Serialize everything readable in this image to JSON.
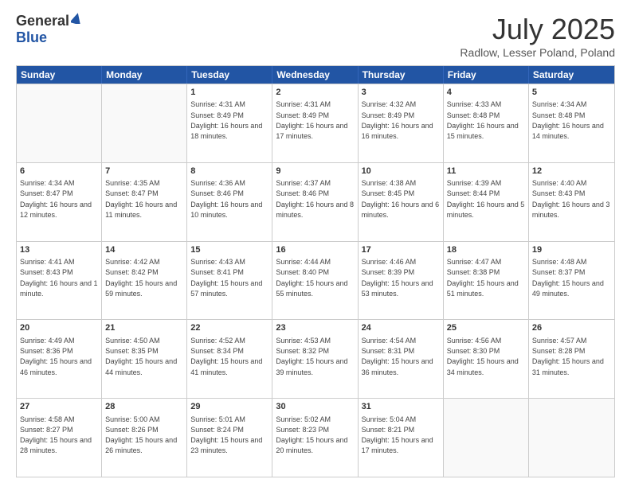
{
  "header": {
    "logo_general": "General",
    "logo_blue": "Blue",
    "month_title": "July 2025",
    "location": "Radlow, Lesser Poland, Poland"
  },
  "weekdays": [
    "Sunday",
    "Monday",
    "Tuesday",
    "Wednesday",
    "Thursday",
    "Friday",
    "Saturday"
  ],
  "weeks": [
    [
      {
        "day": "",
        "sunrise": "",
        "sunset": "",
        "daylight": "",
        "empty": true
      },
      {
        "day": "",
        "sunrise": "",
        "sunset": "",
        "daylight": "",
        "empty": true
      },
      {
        "day": "1",
        "sunrise": "Sunrise: 4:31 AM",
        "sunset": "Sunset: 8:49 PM",
        "daylight": "Daylight: 16 hours and 18 minutes.",
        "empty": false
      },
      {
        "day": "2",
        "sunrise": "Sunrise: 4:31 AM",
        "sunset": "Sunset: 8:49 PM",
        "daylight": "Daylight: 16 hours and 17 minutes.",
        "empty": false
      },
      {
        "day": "3",
        "sunrise": "Sunrise: 4:32 AM",
        "sunset": "Sunset: 8:49 PM",
        "daylight": "Daylight: 16 hours and 16 minutes.",
        "empty": false
      },
      {
        "day": "4",
        "sunrise": "Sunrise: 4:33 AM",
        "sunset": "Sunset: 8:48 PM",
        "daylight": "Daylight: 16 hours and 15 minutes.",
        "empty": false
      },
      {
        "day": "5",
        "sunrise": "Sunrise: 4:34 AM",
        "sunset": "Sunset: 8:48 PM",
        "daylight": "Daylight: 16 hours and 14 minutes.",
        "empty": false
      }
    ],
    [
      {
        "day": "6",
        "sunrise": "Sunrise: 4:34 AM",
        "sunset": "Sunset: 8:47 PM",
        "daylight": "Daylight: 16 hours and 12 minutes.",
        "empty": false
      },
      {
        "day": "7",
        "sunrise": "Sunrise: 4:35 AM",
        "sunset": "Sunset: 8:47 PM",
        "daylight": "Daylight: 16 hours and 11 minutes.",
        "empty": false
      },
      {
        "day": "8",
        "sunrise": "Sunrise: 4:36 AM",
        "sunset": "Sunset: 8:46 PM",
        "daylight": "Daylight: 16 hours and 10 minutes.",
        "empty": false
      },
      {
        "day": "9",
        "sunrise": "Sunrise: 4:37 AM",
        "sunset": "Sunset: 8:46 PM",
        "daylight": "Daylight: 16 hours and 8 minutes.",
        "empty": false
      },
      {
        "day": "10",
        "sunrise": "Sunrise: 4:38 AM",
        "sunset": "Sunset: 8:45 PM",
        "daylight": "Daylight: 16 hours and 6 minutes.",
        "empty": false
      },
      {
        "day": "11",
        "sunrise": "Sunrise: 4:39 AM",
        "sunset": "Sunset: 8:44 PM",
        "daylight": "Daylight: 16 hours and 5 minutes.",
        "empty": false
      },
      {
        "day": "12",
        "sunrise": "Sunrise: 4:40 AM",
        "sunset": "Sunset: 8:43 PM",
        "daylight": "Daylight: 16 hours and 3 minutes.",
        "empty": false
      }
    ],
    [
      {
        "day": "13",
        "sunrise": "Sunrise: 4:41 AM",
        "sunset": "Sunset: 8:43 PM",
        "daylight": "Daylight: 16 hours and 1 minute.",
        "empty": false
      },
      {
        "day": "14",
        "sunrise": "Sunrise: 4:42 AM",
        "sunset": "Sunset: 8:42 PM",
        "daylight": "Daylight: 15 hours and 59 minutes.",
        "empty": false
      },
      {
        "day": "15",
        "sunrise": "Sunrise: 4:43 AM",
        "sunset": "Sunset: 8:41 PM",
        "daylight": "Daylight: 15 hours and 57 minutes.",
        "empty": false
      },
      {
        "day": "16",
        "sunrise": "Sunrise: 4:44 AM",
        "sunset": "Sunset: 8:40 PM",
        "daylight": "Daylight: 15 hours and 55 minutes.",
        "empty": false
      },
      {
        "day": "17",
        "sunrise": "Sunrise: 4:46 AM",
        "sunset": "Sunset: 8:39 PM",
        "daylight": "Daylight: 15 hours and 53 minutes.",
        "empty": false
      },
      {
        "day": "18",
        "sunrise": "Sunrise: 4:47 AM",
        "sunset": "Sunset: 8:38 PM",
        "daylight": "Daylight: 15 hours and 51 minutes.",
        "empty": false
      },
      {
        "day": "19",
        "sunrise": "Sunrise: 4:48 AM",
        "sunset": "Sunset: 8:37 PM",
        "daylight": "Daylight: 15 hours and 49 minutes.",
        "empty": false
      }
    ],
    [
      {
        "day": "20",
        "sunrise": "Sunrise: 4:49 AM",
        "sunset": "Sunset: 8:36 PM",
        "daylight": "Daylight: 15 hours and 46 minutes.",
        "empty": false
      },
      {
        "day": "21",
        "sunrise": "Sunrise: 4:50 AM",
        "sunset": "Sunset: 8:35 PM",
        "daylight": "Daylight: 15 hours and 44 minutes.",
        "empty": false
      },
      {
        "day": "22",
        "sunrise": "Sunrise: 4:52 AM",
        "sunset": "Sunset: 8:34 PM",
        "daylight": "Daylight: 15 hours and 41 minutes.",
        "empty": false
      },
      {
        "day": "23",
        "sunrise": "Sunrise: 4:53 AM",
        "sunset": "Sunset: 8:32 PM",
        "daylight": "Daylight: 15 hours and 39 minutes.",
        "empty": false
      },
      {
        "day": "24",
        "sunrise": "Sunrise: 4:54 AM",
        "sunset": "Sunset: 8:31 PM",
        "daylight": "Daylight: 15 hours and 36 minutes.",
        "empty": false
      },
      {
        "day": "25",
        "sunrise": "Sunrise: 4:56 AM",
        "sunset": "Sunset: 8:30 PM",
        "daylight": "Daylight: 15 hours and 34 minutes.",
        "empty": false
      },
      {
        "day": "26",
        "sunrise": "Sunrise: 4:57 AM",
        "sunset": "Sunset: 8:28 PM",
        "daylight": "Daylight: 15 hours and 31 minutes.",
        "empty": false
      }
    ],
    [
      {
        "day": "27",
        "sunrise": "Sunrise: 4:58 AM",
        "sunset": "Sunset: 8:27 PM",
        "daylight": "Daylight: 15 hours and 28 minutes.",
        "empty": false
      },
      {
        "day": "28",
        "sunrise": "Sunrise: 5:00 AM",
        "sunset": "Sunset: 8:26 PM",
        "daylight": "Daylight: 15 hours and 26 minutes.",
        "empty": false
      },
      {
        "day": "29",
        "sunrise": "Sunrise: 5:01 AM",
        "sunset": "Sunset: 8:24 PM",
        "daylight": "Daylight: 15 hours and 23 minutes.",
        "empty": false
      },
      {
        "day": "30",
        "sunrise": "Sunrise: 5:02 AM",
        "sunset": "Sunset: 8:23 PM",
        "daylight": "Daylight: 15 hours and 20 minutes.",
        "empty": false
      },
      {
        "day": "31",
        "sunrise": "Sunrise: 5:04 AM",
        "sunset": "Sunset: 8:21 PM",
        "daylight": "Daylight: 15 hours and 17 minutes.",
        "empty": false
      },
      {
        "day": "",
        "sunrise": "",
        "sunset": "",
        "daylight": "",
        "empty": true
      },
      {
        "day": "",
        "sunrise": "",
        "sunset": "",
        "daylight": "",
        "empty": true
      }
    ]
  ]
}
